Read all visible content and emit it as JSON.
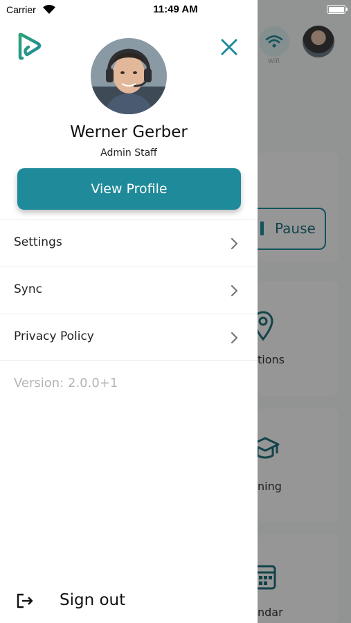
{
  "status_bar": {
    "carrier": "Carrier",
    "time": "11:49 AM",
    "wifi_icon": "wifi-icon",
    "battery_icon": "battery-icon"
  },
  "background_app": {
    "wifi_label": "Wifi",
    "pause_label": "Pause",
    "card_labels": [
      "tions",
      "ning",
      "ndar"
    ]
  },
  "drawer": {
    "logo_icon": "app-logo-icon",
    "close_icon": "close-icon",
    "user": {
      "name": "Werner Gerber",
      "role": "Admin Staff"
    },
    "view_profile_label": "View Profile",
    "menu_items": [
      {
        "label": "Settings",
        "icon": "chevron-right-icon"
      },
      {
        "label": "Sync",
        "icon": "chevron-right-icon"
      },
      {
        "label": "Privacy Policy",
        "icon": "chevron-right-icon"
      }
    ],
    "version": "Version: 2.0.0+1",
    "sign_out_label": "Sign out",
    "sign_out_icon": "sign-out-icon"
  },
  "colors": {
    "accent": "#1f8a99",
    "logo_green": "#2ea37a",
    "text_muted": "#b5b5b5",
    "overlay": "rgba(0,0,0,0.40)"
  }
}
